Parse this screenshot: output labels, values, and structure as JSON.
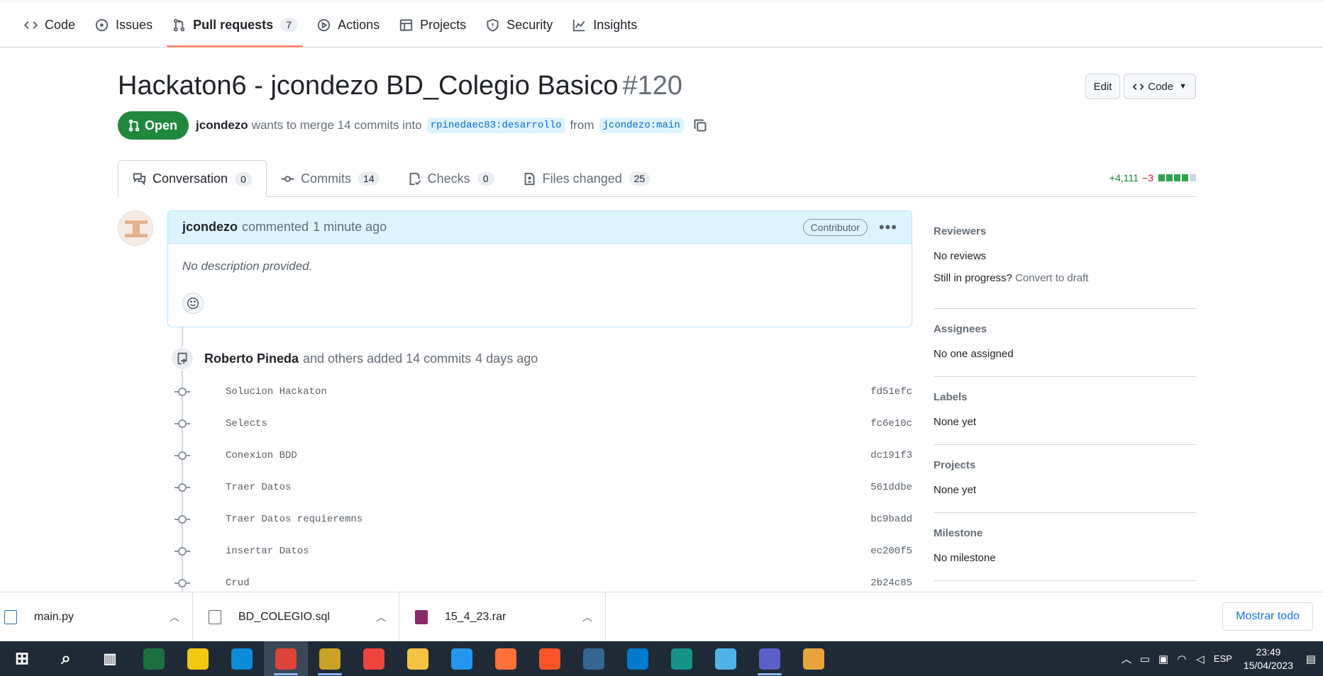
{
  "repo_nav": {
    "items": [
      {
        "label": "Code",
        "icon": "code-icon"
      },
      {
        "label": "Issues",
        "icon": "issue-opened-icon"
      },
      {
        "label": "Pull requests",
        "icon": "git-pull-request-icon",
        "count": "7"
      },
      {
        "label": "Actions",
        "icon": "play-icon"
      },
      {
        "label": "Projects",
        "icon": "table-icon"
      },
      {
        "label": "Security",
        "icon": "shield-icon"
      },
      {
        "label": "Insights",
        "icon": "graph-icon"
      }
    ]
  },
  "pr": {
    "title": "Hackaton6 - jcondezo BD_Colegio Basico",
    "number": "#120",
    "edit_label": "Edit",
    "code_label": "Code",
    "state": "Open",
    "author": "jcondezo",
    "merge_text": "wants to merge 14 commits into",
    "base_branch": "rpinedaec83:desarrollo",
    "from_text": "from",
    "head_branch": "jcondezo:main"
  },
  "tabs": [
    {
      "label": "Conversation",
      "count": "0",
      "icon": "comment-discussion-icon"
    },
    {
      "label": "Commits",
      "count": "14",
      "icon": "git-commit-icon"
    },
    {
      "label": "Checks",
      "count": "0",
      "icon": "checklist-icon"
    },
    {
      "label": "Files changed",
      "count": "25",
      "icon": "file-diff-icon"
    }
  ],
  "diffstat": {
    "additions": "+4,111",
    "deletions": "−3",
    "green_blocks": 4,
    "neutral_blocks": 1
  },
  "comment": {
    "author": "jcondezo",
    "action": "commented",
    "time": "1 minute ago",
    "role": "Contributor",
    "body": "No description provided."
  },
  "timeline_event": {
    "author": "Roberto Pineda",
    "text": "and others added 14 commits",
    "time": "4 days ago"
  },
  "commits": [
    {
      "message": "Solucion Hackaton",
      "sha": "fd51efc"
    },
    {
      "message": "Selects",
      "sha": "fc6e10c"
    },
    {
      "message": "Conexion BDD",
      "sha": "dc191f3"
    },
    {
      "message": "Traer Datos",
      "sha": "561ddbe"
    },
    {
      "message": "Traer Datos requieremns",
      "sha": "bc9badd"
    },
    {
      "message": "insertar Datos",
      "sha": "ec200f5"
    },
    {
      "message": "Crud",
      "sha": "2b24c85"
    }
  ],
  "sidebar": {
    "reviewers": {
      "title": "Reviewers",
      "value": "No reviews",
      "progress_text": "Still in progress?",
      "draft_link": "Convert to draft"
    },
    "assignees": {
      "title": "Assignees",
      "value": "No one assigned"
    },
    "labels": {
      "title": "Labels",
      "value": "None yet"
    },
    "projects": {
      "title": "Projects",
      "value": "None yet"
    },
    "milestone": {
      "title": "Milestone",
      "value": "No milestone"
    }
  },
  "downloads": {
    "items": [
      {
        "name": "main.py",
        "icon": "python-file-icon"
      },
      {
        "name": "BD_COLEGIO.sql",
        "icon": "sql-file-icon"
      },
      {
        "name": "15_4_23.rar",
        "icon": "rar-archive-icon"
      }
    ],
    "show_all": "Mostrar todo"
  },
  "taskbar": {
    "apps": [
      {
        "name": "windows-start-icon",
        "color": "#1f2a36"
      },
      {
        "name": "search-icon",
        "color": "#1f2a36"
      },
      {
        "name": "task-view-icon",
        "color": "#1f2a36"
      },
      {
        "name": "excel-icon",
        "color": "#1d6f42"
      },
      {
        "name": "power-bi-icon",
        "color": "#f2c811"
      },
      {
        "name": "edge-icon",
        "color": "#0c8bd6"
      },
      {
        "name": "chrome-icon",
        "color": "#db4437"
      },
      {
        "name": "sql-tool-icon",
        "color": "#c9a227"
      },
      {
        "name": "anydesk-icon",
        "color": "#ef443b"
      },
      {
        "name": "file-explorer-icon",
        "color": "#f5c342"
      },
      {
        "name": "docker-icon",
        "color": "#2496ed"
      },
      {
        "name": "firefox-icon",
        "color": "#ff7139"
      },
      {
        "name": "brave-icon",
        "color": "#fb542b"
      },
      {
        "name": "postgresql-icon",
        "color": "#336791"
      },
      {
        "name": "vscode-icon",
        "color": "#007acc"
      },
      {
        "name": "git-kraken-icon",
        "color": "#179287"
      },
      {
        "name": "notepad-icon",
        "color": "#4fb3e8"
      },
      {
        "name": "teams-icon",
        "color": "#5b5fc7"
      },
      {
        "name": "paint-icon",
        "color": "#e8a33d"
      }
    ],
    "language": "ESP",
    "time": "23:49",
    "date": "15/04/2023"
  }
}
